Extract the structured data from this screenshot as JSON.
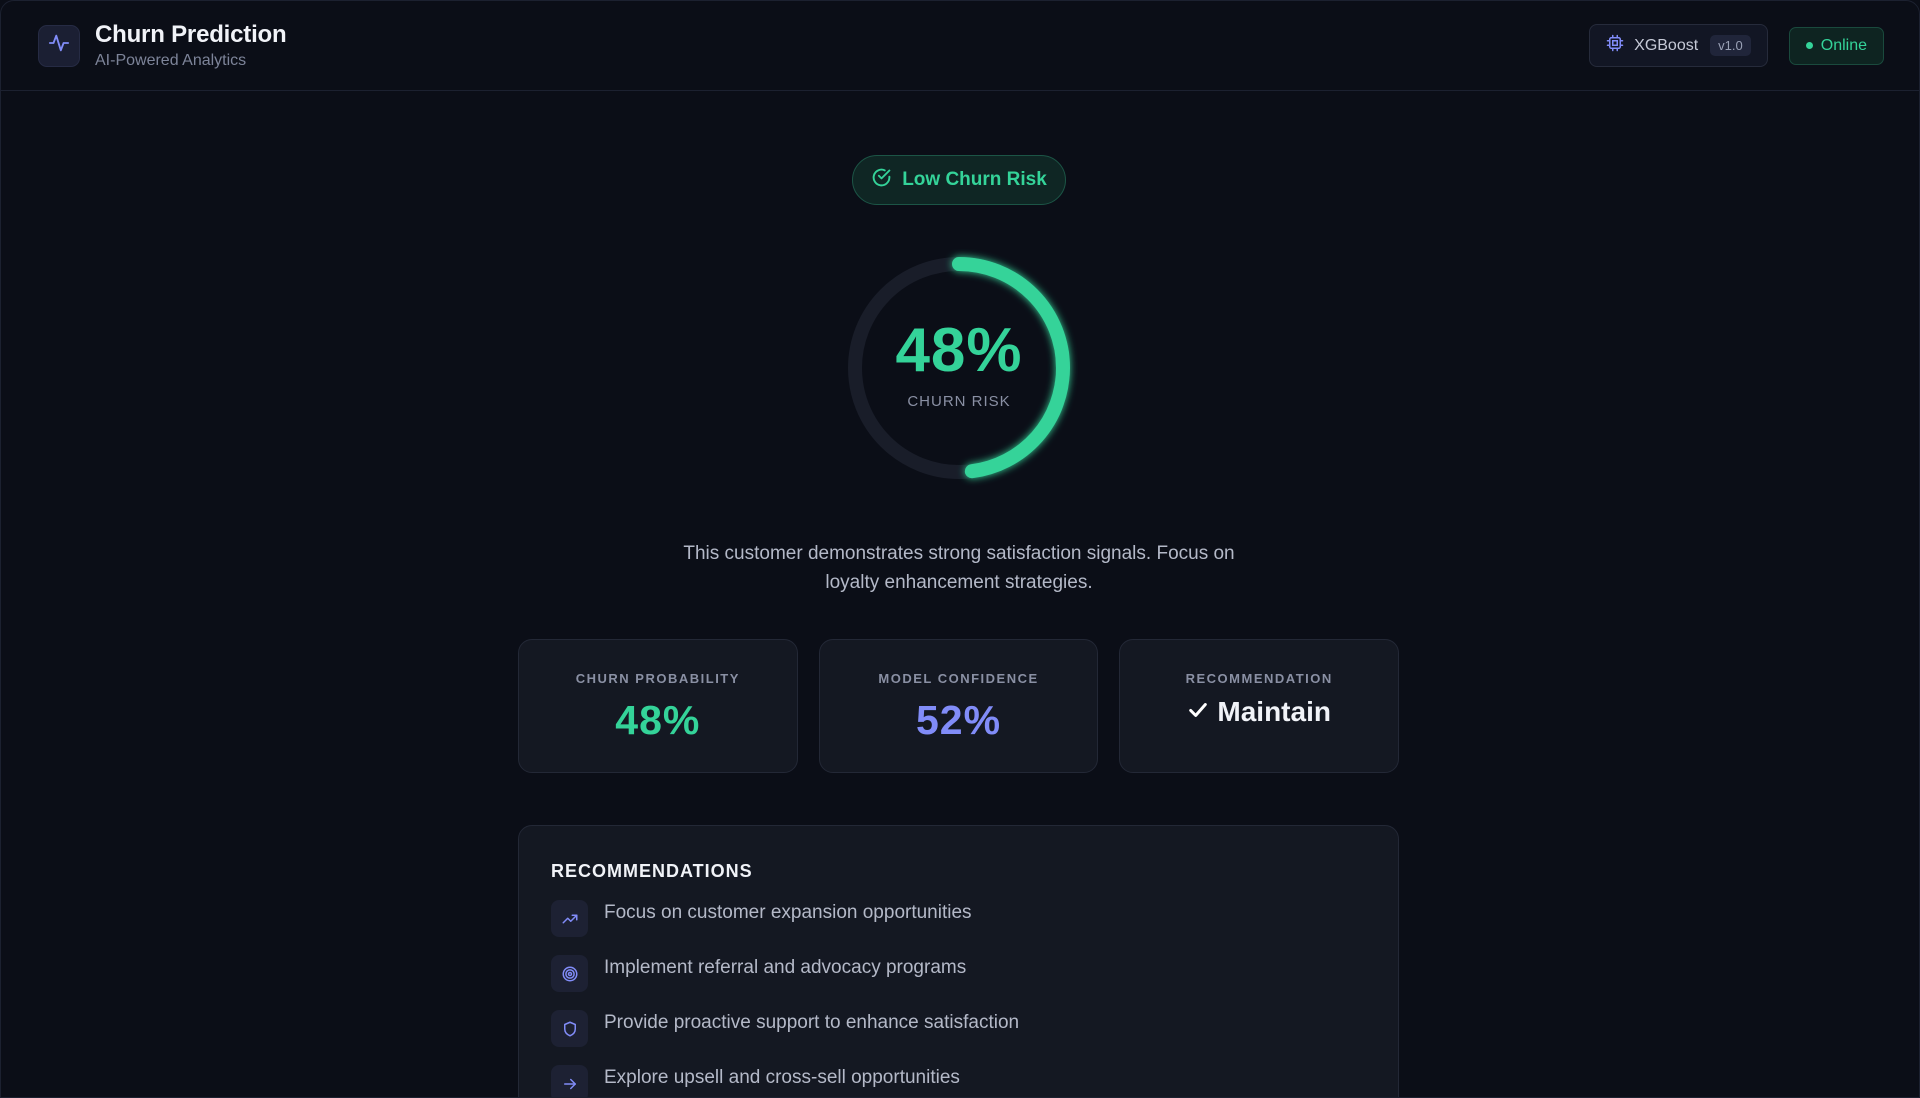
{
  "header": {
    "title": "Churn Prediction",
    "subtitle": "AI-Powered Analytics",
    "model_name": "XGBoost",
    "model_version": "v1.0",
    "status": "Online"
  },
  "risk": {
    "badge_label": "Low Churn Risk",
    "gauge_value": "48%",
    "gauge_fraction": 0.48,
    "gauge_label": "CHURN RISK",
    "summary": "This customer demonstrates strong satisfaction signals. Focus on loyalty enhancement strategies."
  },
  "stats": {
    "probability_label": "CHURN PROBABILITY",
    "probability_value": "48%",
    "confidence_label": "MODEL CONFIDENCE",
    "confidence_value": "52%",
    "recommendation_label": "RECOMMENDATION",
    "recommendation_value": "Maintain"
  },
  "recommendations": {
    "title": "RECOMMENDATIONS",
    "items": [
      {
        "icon": "trending-up-icon",
        "text": "Focus on customer expansion opportunities"
      },
      {
        "icon": "target-icon",
        "text": "Implement referral and advocacy programs"
      },
      {
        "icon": "shield-icon",
        "text": "Provide proactive support to enhance satisfaction"
      },
      {
        "icon": "arrow-right-icon",
        "text": "Explore upsell and cross-sell opportunities"
      }
    ]
  },
  "colors": {
    "accent_green": "#34d399",
    "accent_indigo": "#818cf8",
    "background": "#0b0e17",
    "card": "#141822"
  }
}
